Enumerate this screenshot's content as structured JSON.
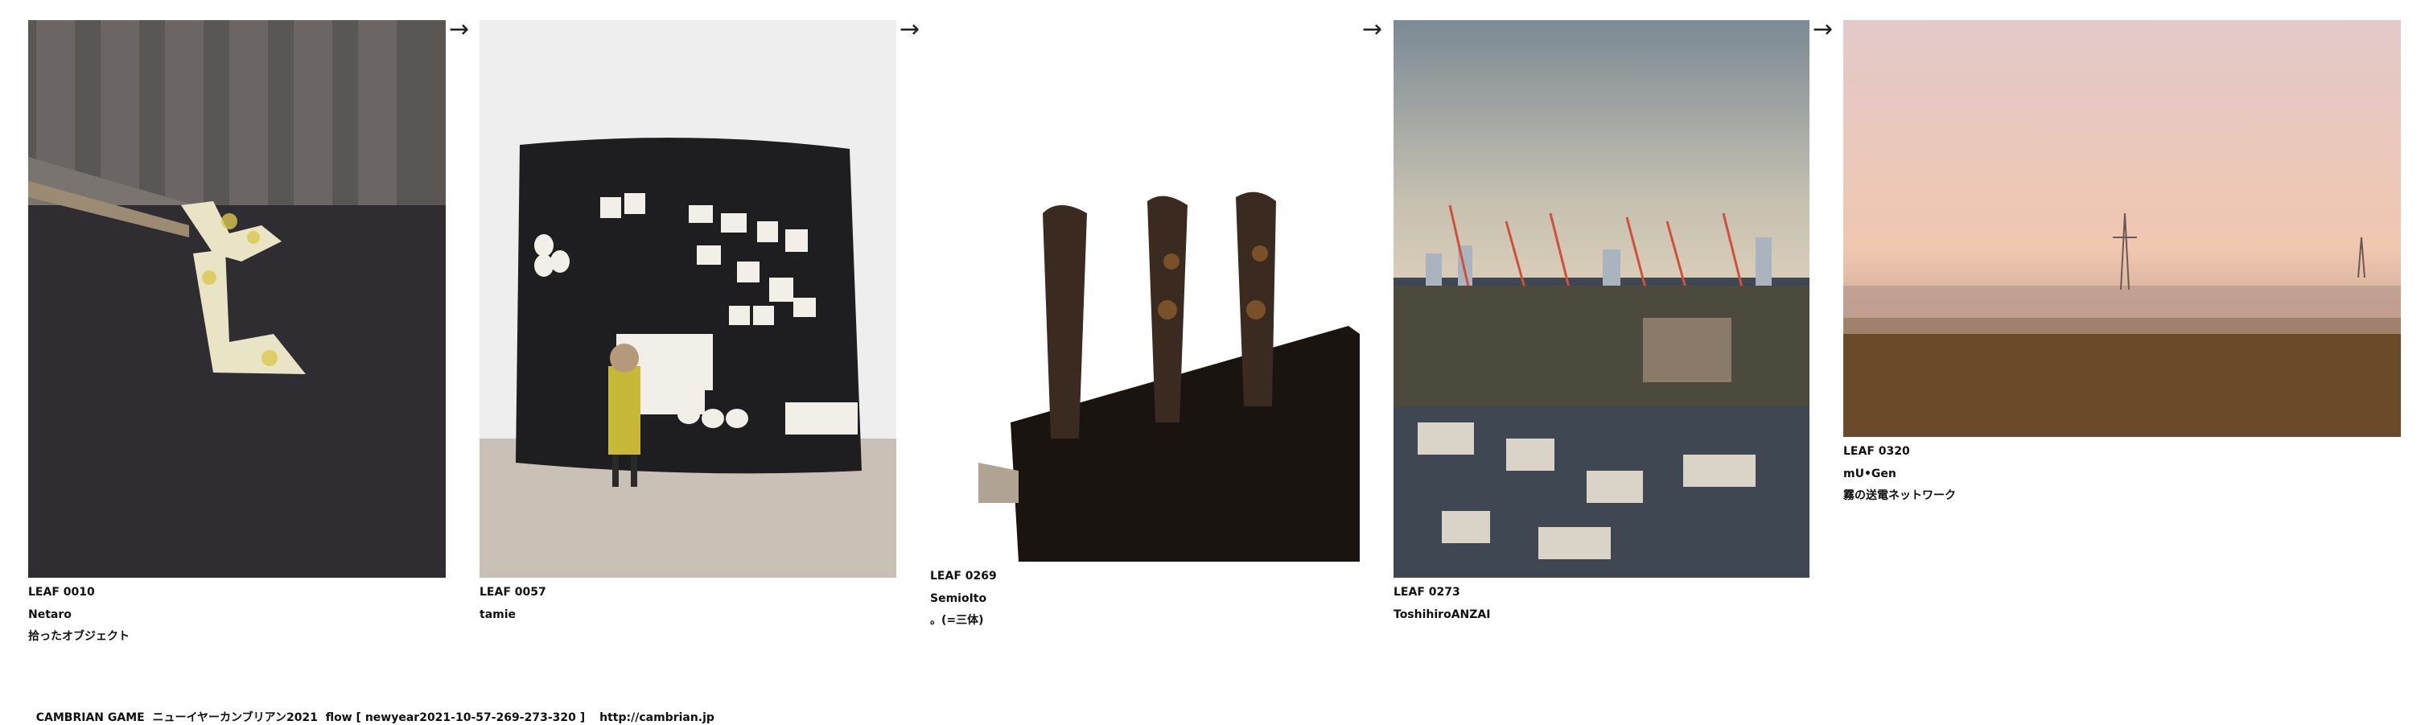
{
  "leaves": [
    {
      "id": "LEAF 0010",
      "author": "Netaro",
      "title": "拾ったオブジェクト"
    },
    {
      "id": "LEAF 0057",
      "author": "tamie",
      "title": ""
    },
    {
      "id": "LEAF 0269",
      "author": "SemioIto",
      "title": "。(=三体)"
    },
    {
      "id": "LEAF 0273",
      "author": "ToshihiroANZAI",
      "title": ""
    },
    {
      "id": "LEAF 0320",
      "author": "mU•Gen",
      "title": "霧の送電ネットワーク"
    }
  ],
  "arrow_symbol": "→",
  "footer": {
    "text": "CAMBRIAN GAME  ニューイヤーカンブリアン2021  flow [ newyear2021-10-57-269-273-320 ]",
    "link": "http://cambrian.jp"
  }
}
